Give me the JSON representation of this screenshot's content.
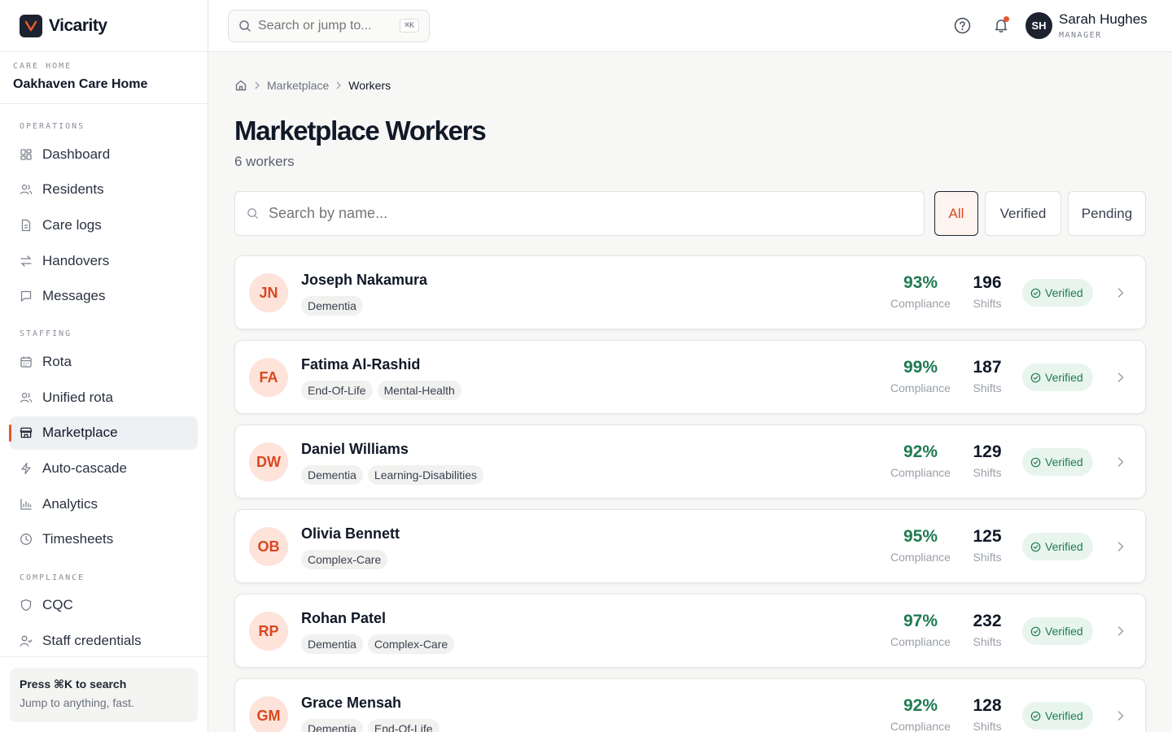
{
  "app": {
    "name": "Vicarity"
  },
  "care_home": {
    "caption": "CARE HOME",
    "name": "Oakhaven Care Home"
  },
  "sidebar": {
    "sections": [
      {
        "label": "OPERATIONS",
        "items": [
          {
            "label": "Dashboard",
            "icon": "dashboard-icon"
          },
          {
            "label": "Residents",
            "icon": "users-icon"
          },
          {
            "label": "Care logs",
            "icon": "document-icon"
          },
          {
            "label": "Handovers",
            "icon": "swap-icon"
          },
          {
            "label": "Messages",
            "icon": "message-icon"
          }
        ]
      },
      {
        "label": "STAFFING",
        "items": [
          {
            "label": "Rota",
            "icon": "calendar-icon"
          },
          {
            "label": "Unified rota",
            "icon": "users-icon"
          },
          {
            "label": "Marketplace",
            "icon": "store-icon",
            "active": true
          },
          {
            "label": "Auto-cascade",
            "icon": "bolt-icon"
          },
          {
            "label": "Analytics",
            "icon": "bar-chart-icon"
          },
          {
            "label": "Timesheets",
            "icon": "clock-icon"
          }
        ]
      },
      {
        "label": "COMPLIANCE",
        "items": [
          {
            "label": "CQC",
            "icon": "shield-icon"
          },
          {
            "label": "Staff credentials",
            "icon": "user-check-icon"
          }
        ]
      }
    ],
    "footer": {
      "title": "Press ⌘K to search",
      "subtitle": "Jump to anything, fast."
    }
  },
  "topbar": {
    "search_placeholder": "Search or jump to...",
    "shortcut": "⌘K",
    "user": {
      "initials": "SH",
      "name": "Sarah Hughes",
      "role": "MANAGER"
    }
  },
  "breadcrumb": {
    "parent": "Marketplace",
    "current": "Workers"
  },
  "page": {
    "title": "Marketplace Workers",
    "subtitle": "6 workers"
  },
  "filters": {
    "search_placeholder": "Search by name...",
    "options": [
      "All",
      "Verified",
      "Pending"
    ],
    "selected": "All"
  },
  "colors": {
    "accent": "#e4572e",
    "brand_dark": "#1c2230",
    "success": "#1f7a52"
  },
  "stat_labels": {
    "compliance": "Compliance",
    "shifts": "Shifts"
  },
  "workers": [
    {
      "initials": "JN",
      "name": "Joseph Nakamura",
      "tags": [
        "Dementia"
      ],
      "compliance": "93%",
      "shifts": "196",
      "status": "Verified"
    },
    {
      "initials": "FA",
      "name": "Fatima Al-Rashid",
      "tags": [
        "End-Of-Life",
        "Mental-Health"
      ],
      "compliance": "99%",
      "shifts": "187",
      "status": "Verified"
    },
    {
      "initials": "DW",
      "name": "Daniel Williams",
      "tags": [
        "Dementia",
        "Learning-Disabilities"
      ],
      "compliance": "92%",
      "shifts": "129",
      "status": "Verified"
    },
    {
      "initials": "OB",
      "name": "Olivia Bennett",
      "tags": [
        "Complex-Care"
      ],
      "compliance": "95%",
      "shifts": "125",
      "status": "Verified"
    },
    {
      "initials": "RP",
      "name": "Rohan Patel",
      "tags": [
        "Dementia",
        "Complex-Care"
      ],
      "compliance": "97%",
      "shifts": "232",
      "status": "Verified"
    },
    {
      "initials": "GM",
      "name": "Grace Mensah",
      "tags": [
        "Dementia",
        "End-Of-Life"
      ],
      "compliance": "92%",
      "shifts": "128",
      "status": "Verified"
    }
  ]
}
